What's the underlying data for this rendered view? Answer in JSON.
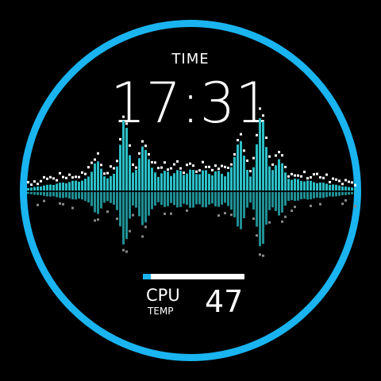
{
  "clock": {
    "label": "TIME",
    "time": "17:31"
  },
  "cpu": {
    "label": "CPU",
    "sublabel": "TEMP",
    "value": "47",
    "progress_fraction": 0.08
  },
  "colors": {
    "ring": "#1ab4f0",
    "bars": "#2bbfc6",
    "peaks": "#ffffff",
    "progress_fill": "#1ab4f0",
    "progress_track": "#ffffff"
  }
}
